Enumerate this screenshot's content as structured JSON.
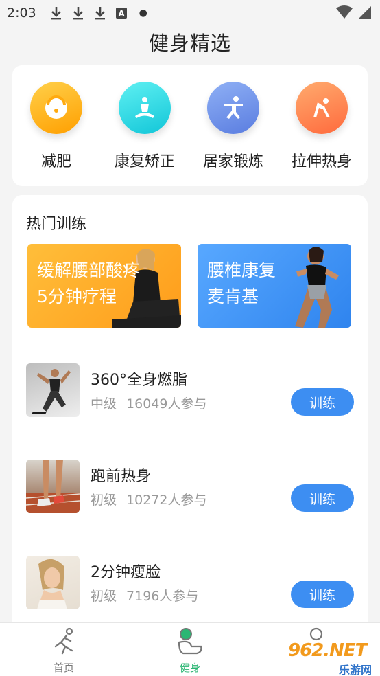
{
  "status_bar": {
    "time": "2:03",
    "icons": [
      "download-icon",
      "download-icon",
      "download-icon",
      "a-badge-icon",
      "dot-icon",
      "wifi-icon",
      "signal-icon"
    ]
  },
  "page": {
    "title": "健身精选"
  },
  "categories": [
    {
      "label": "减肥",
      "icon": "scale-icon",
      "color": "#ffb300"
    },
    {
      "label": "康复矫正",
      "icon": "meditation-icon",
      "color": "#1ecfe0"
    },
    {
      "label": "居家锻炼",
      "icon": "exercise-icon",
      "color": "#6c8ee6"
    },
    {
      "label": "拉伸热身",
      "icon": "stretch-icon",
      "color": "#ff7a45"
    }
  ],
  "hot": {
    "title": "热门训练",
    "banners": [
      {
        "line1": "缓解腰部酸疼",
        "line2": "5分钟疗程",
        "color": "#ffa928"
      },
      {
        "line1": "腰椎康复",
        "line2": "麦肯基",
        "color": "#3f95f4"
      }
    ],
    "items": [
      {
        "title": "360°全身燃脂",
        "level": "中级",
        "participants": "16049人参与",
        "button": "训练"
      },
      {
        "title": "跑前热身",
        "level": "初级",
        "participants": "10272人参与",
        "button": "训练"
      },
      {
        "title": "2分钟瘦脸",
        "level": "初级",
        "participants": "7196人参与",
        "button": "训练"
      }
    ]
  },
  "tabs": [
    {
      "label": "首页",
      "icon": "run-icon",
      "active": false
    },
    {
      "label": "健身",
      "icon": "fitness-icon",
      "active": true
    },
    {
      "label": "",
      "icon": "profile-icon",
      "active": false
    }
  ],
  "watermark": {
    "main": "962.NET",
    "sub": "乐游网"
  },
  "colors": {
    "accent": "#3d8ef2",
    "active_tab": "#2bb673"
  }
}
